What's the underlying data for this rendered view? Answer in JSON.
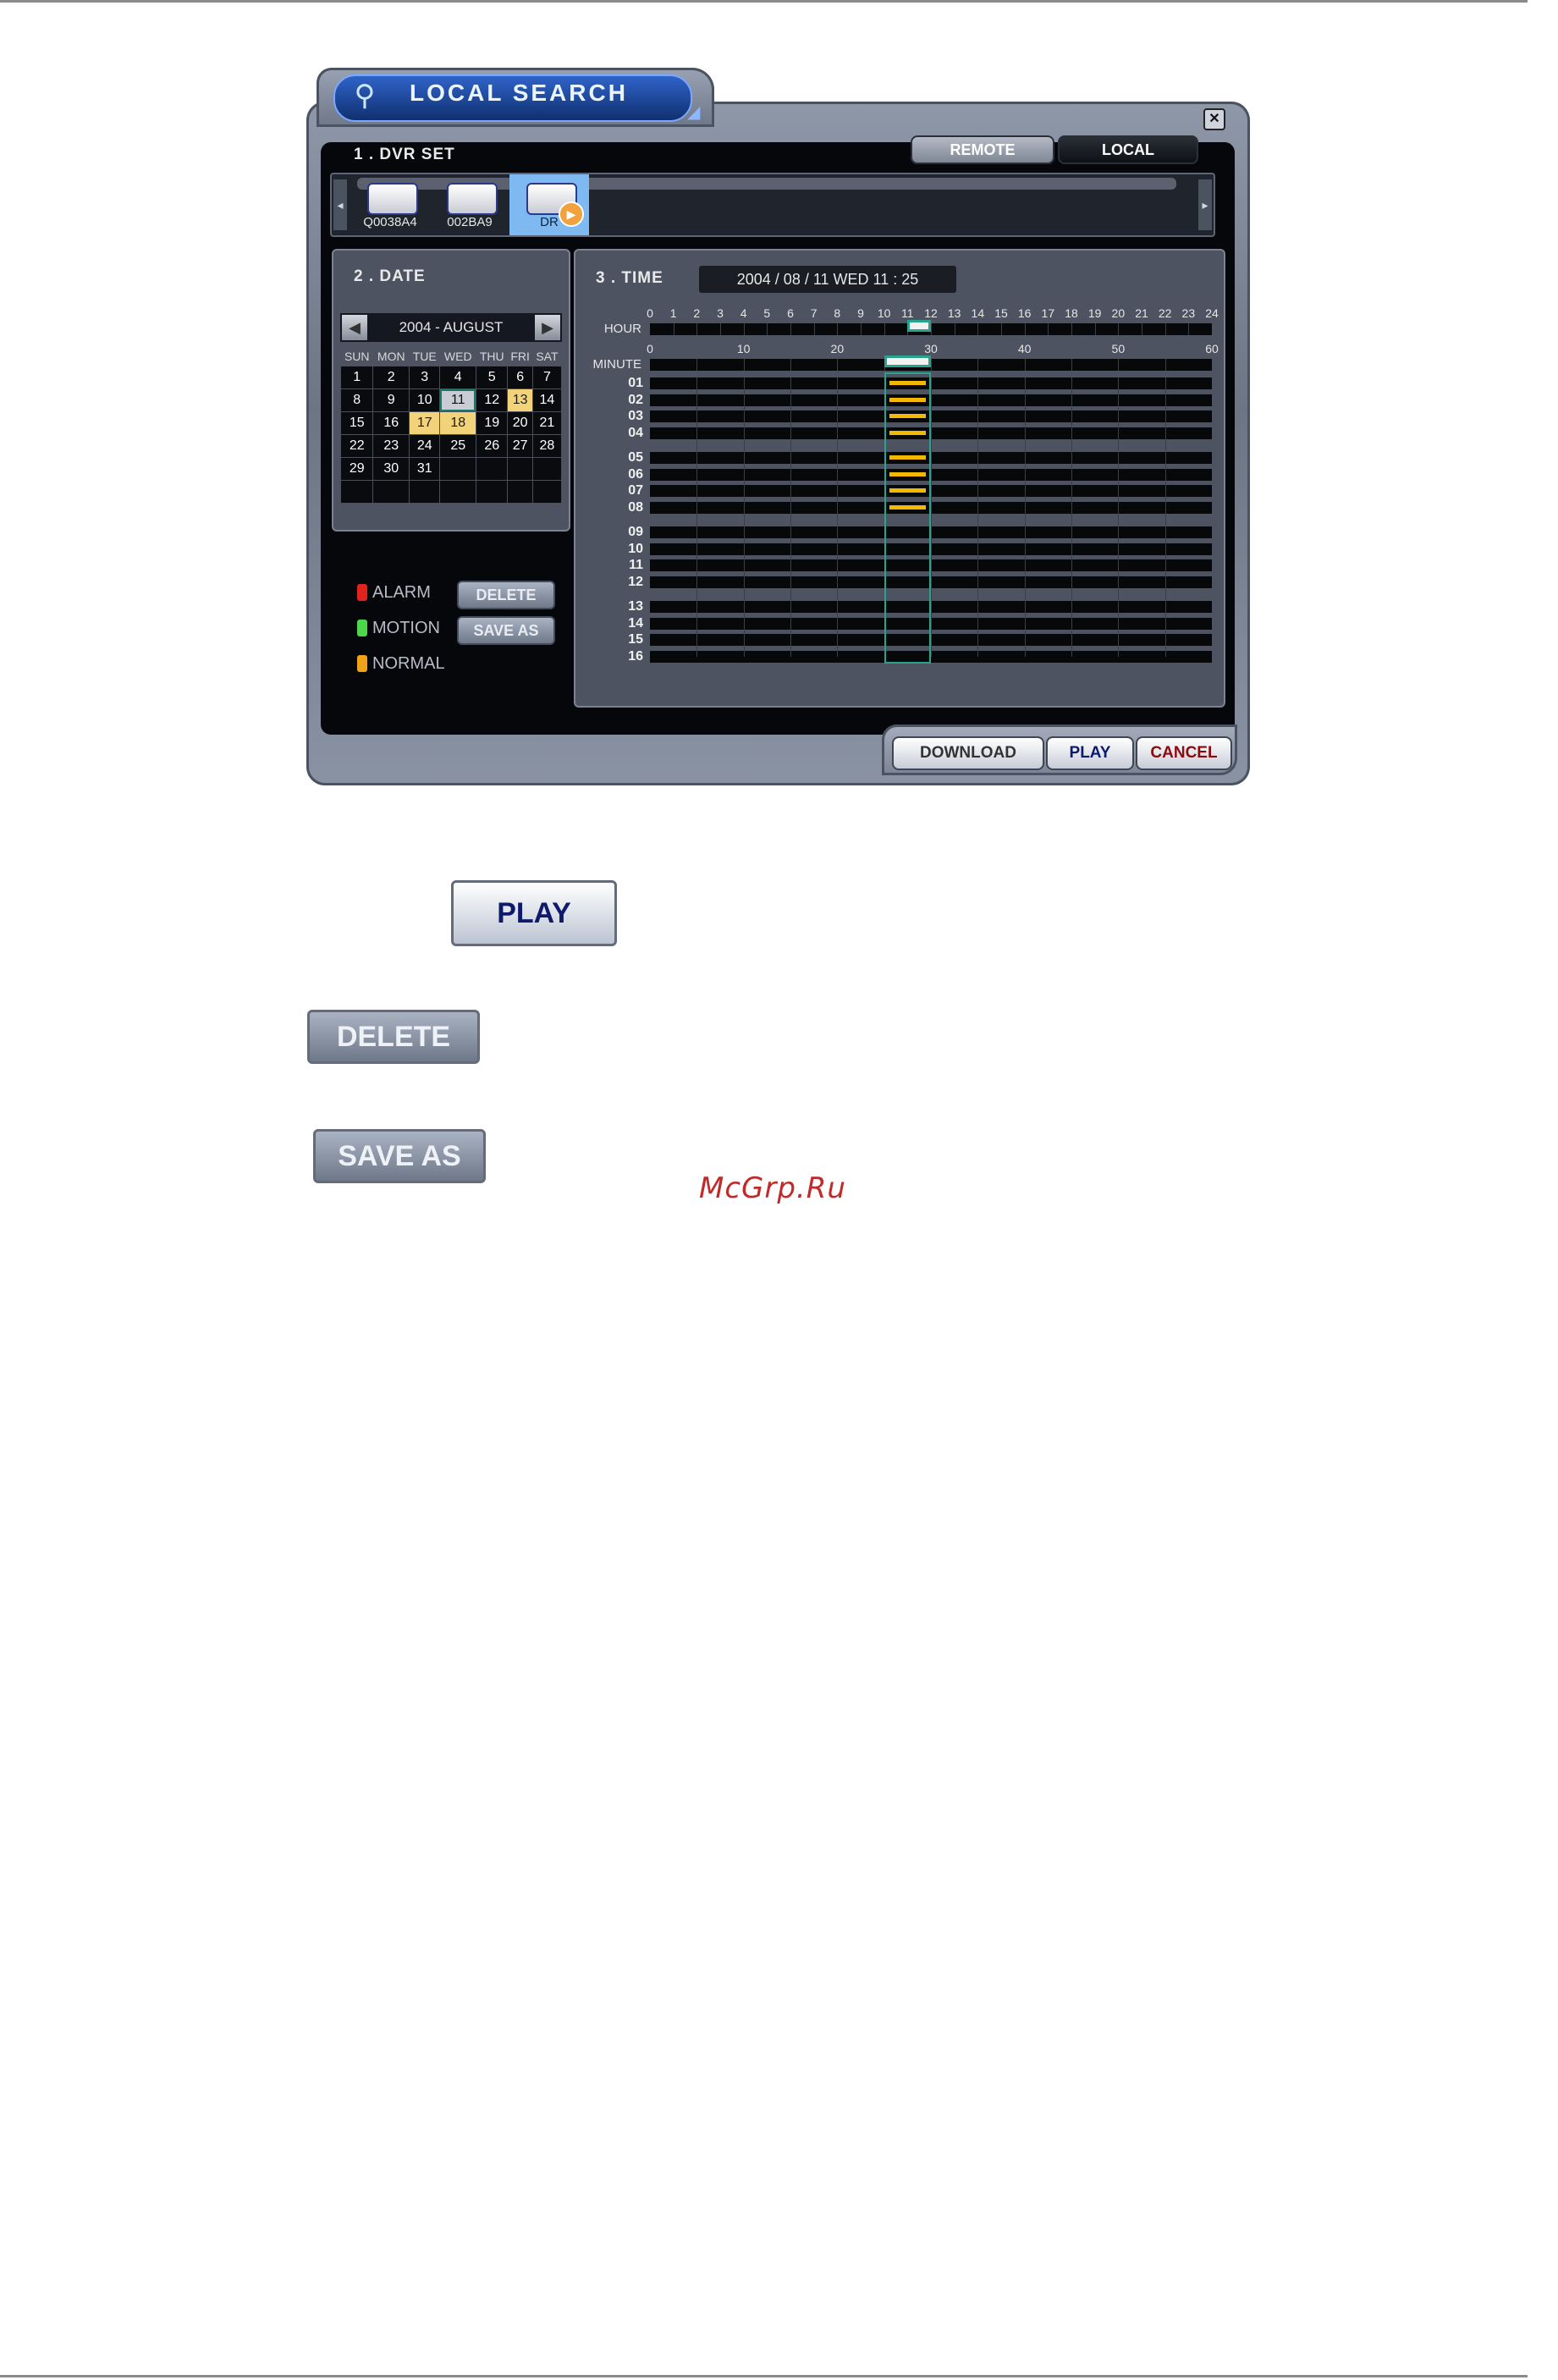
{
  "window": {
    "title": "LOCAL SEARCH",
    "close_glyph": "✕",
    "section_dvr": "1 . DVR SET",
    "section_date": "2 . DATE",
    "section_time": "3 . TIME",
    "tabs": [
      {
        "label": "REMOTE"
      },
      {
        "label": "LOCAL"
      }
    ],
    "dvr_items": [
      {
        "name": "Q0038A4"
      },
      {
        "name": "002BA9"
      },
      {
        "name": "DR"
      }
    ],
    "scroll_left": "◂",
    "scroll_right": "▸"
  },
  "date": {
    "month_label": "2004 - AUGUST",
    "prev_glyph": "◀",
    "next_glyph": "▶",
    "weekdays": [
      "SUN",
      "MON",
      "TUE",
      "WED",
      "THU",
      "FRI",
      "SAT"
    ],
    "weeks": [
      [
        "1",
        "2",
        "3",
        "4",
        "5",
        "6",
        "7"
      ],
      [
        "8",
        "9",
        "10",
        "11",
        "12",
        "13",
        "14"
      ],
      [
        "15",
        "16",
        "17",
        "18",
        "19",
        "20",
        "21"
      ],
      [
        "22",
        "23",
        "24",
        "25",
        "26",
        "27",
        "28"
      ],
      [
        "29",
        "30",
        "31",
        "",
        "",
        "",
        ""
      ],
      [
        "",
        "",
        "",
        "",
        "",
        "",
        ""
      ]
    ],
    "recorded_days": [
      "13",
      "17",
      "18"
    ],
    "selected_day": "11"
  },
  "legend": [
    {
      "label": "ALARM",
      "color": "#e0231d"
    },
    {
      "label": "MOTION",
      "color": "#4bd84b"
    },
    {
      "label": "NORMAL",
      "color": "#f0a317"
    }
  ],
  "side_buttons": {
    "delete": "DELETE",
    "save_as": "SAVE AS"
  },
  "time": {
    "readout": "2004 / 08 / 11 WED 11 : 25",
    "hour_label": "HOUR",
    "minute_label": "MINUTE",
    "hour_ticks": [
      "0",
      "1",
      "2",
      "3",
      "4",
      "5",
      "6",
      "7",
      "8",
      "9",
      "10",
      "11",
      "12",
      "13",
      "14",
      "15",
      "16",
      "17",
      "18",
      "19",
      "20",
      "21",
      "22",
      "23",
      "24"
    ],
    "minute_ticks": [
      "0",
      "10",
      "20",
      "30",
      "40",
      "50",
      "60"
    ],
    "selected_hour": 11,
    "selected_minute": 25,
    "channels": [
      "01",
      "02",
      "03",
      "04",
      "05",
      "06",
      "07",
      "08",
      "09",
      "10",
      "11",
      "12",
      "13",
      "14",
      "15",
      "16"
    ],
    "normal_channels": [
      "01",
      "02",
      "03",
      "04",
      "05",
      "06",
      "07",
      "08"
    ],
    "recording_color": "#f5b800"
  },
  "bottom_buttons": {
    "download": "DOWNLOAD",
    "play": "PLAY",
    "cancel": "CANCEL"
  },
  "standalone_buttons": {
    "play": "PLAY",
    "delete": "DELETE",
    "save_as": "SAVE AS"
  },
  "watermark": "McGrp.Ru"
}
